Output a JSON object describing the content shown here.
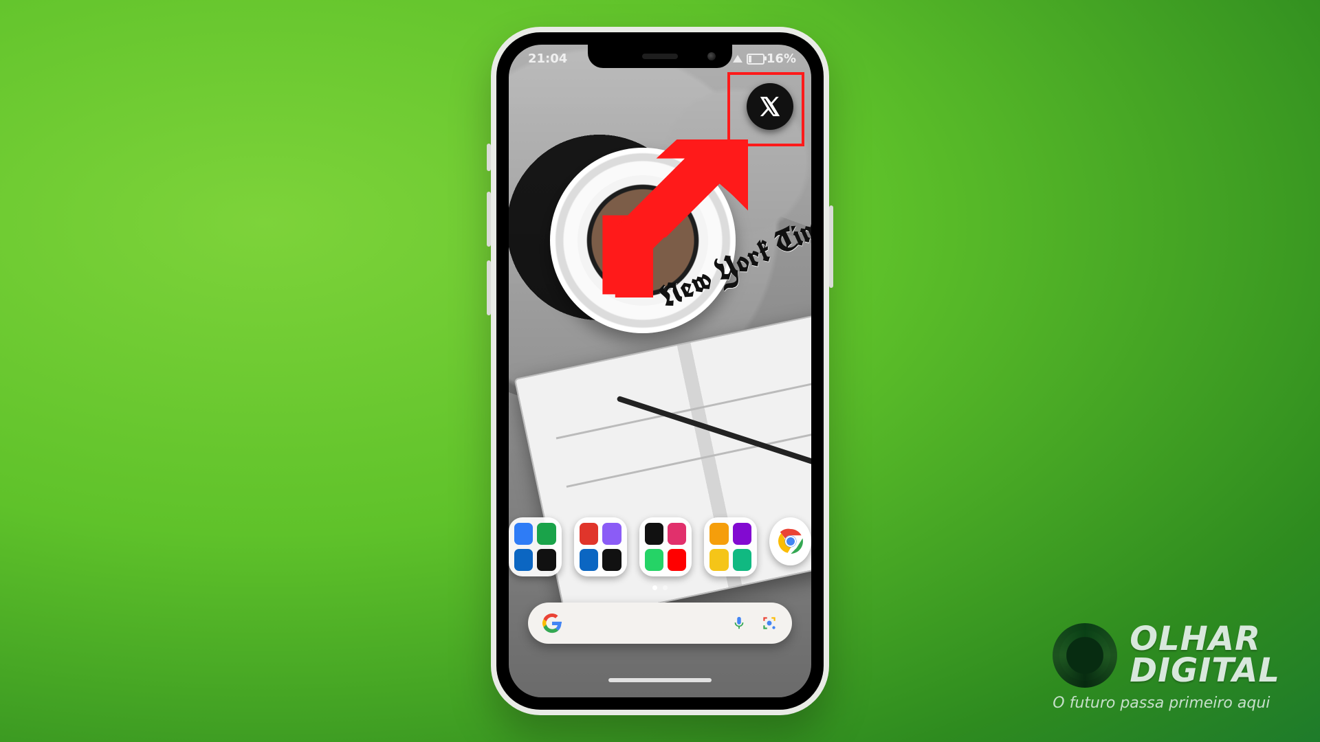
{
  "status": {
    "time": "21:04",
    "battery_pct": "16%"
  },
  "highlight": {
    "app_name": "x-app"
  },
  "wallpaper": {
    "newspaper_masthead": "New York Tim"
  },
  "folders": [
    {
      "name": "folder-communications",
      "minis": [
        "#2e7cf6",
        "#1aa34a",
        "#0b66c2",
        "#111111"
      ]
    },
    {
      "name": "folder-work",
      "minis": [
        "#e0352b",
        "#8b5cf6",
        "#0b66c2",
        "#111111"
      ]
    },
    {
      "name": "folder-social",
      "minis": [
        "#111111",
        "#e1306c",
        "#25d366",
        "#ff0000"
      ]
    },
    {
      "name": "folder-finance",
      "minis": [
        "#f59e0b",
        "#820ad1",
        "#f5c518",
        "#10b981"
      ]
    }
  ],
  "search": {
    "placeholder": ""
  },
  "brand": {
    "line1": "OLHAR",
    "line2": "DIGITAL",
    "tagline": "O futuro passa primeiro aqui"
  }
}
